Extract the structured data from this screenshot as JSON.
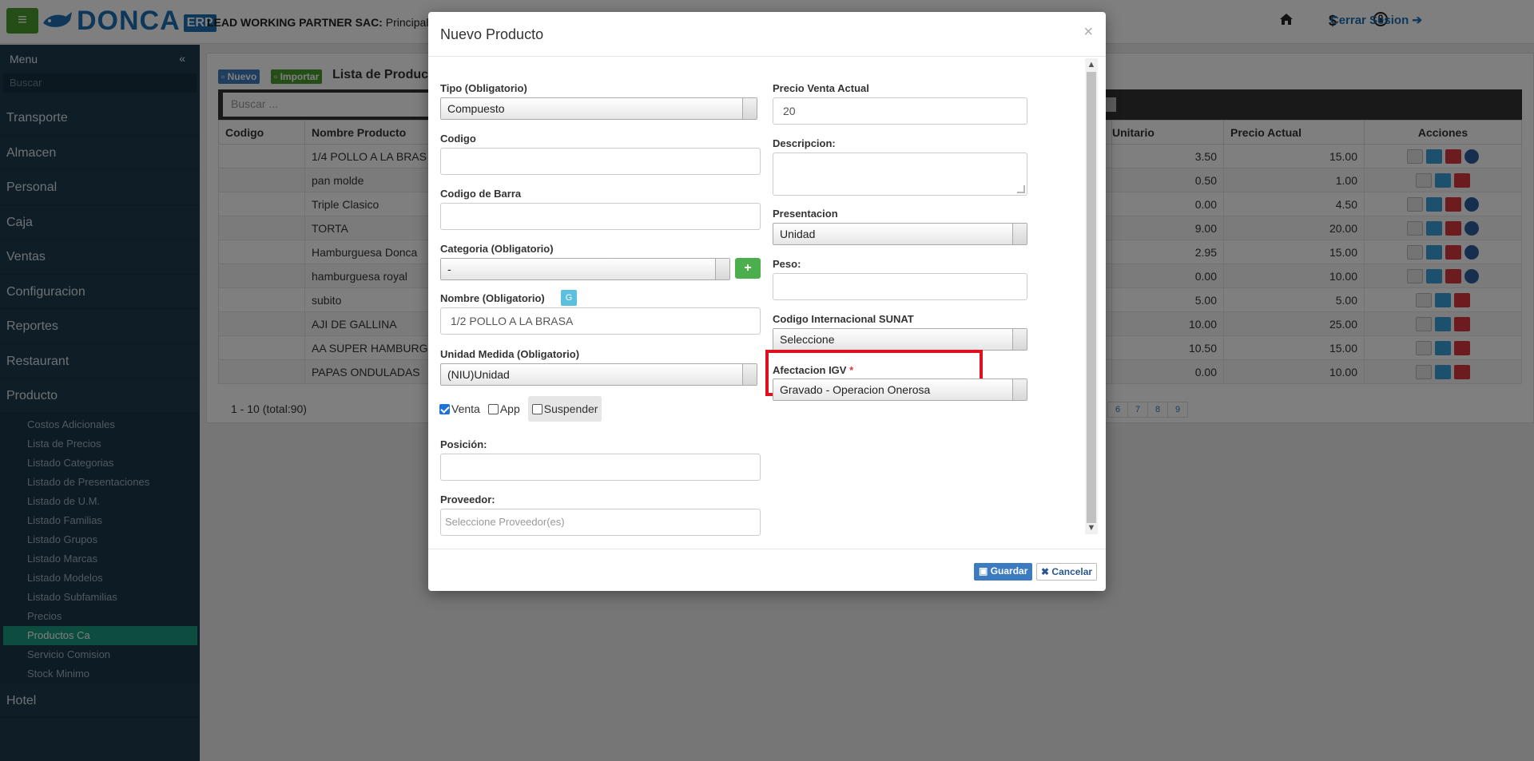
{
  "header": {
    "brand": "DONCA",
    "brand_suffix": "ERP",
    "company_name": "LEAD WORKING PARTNER SAC:",
    "company_branch": "Principal",
    "logout_label": "Cerrar Sesion"
  },
  "sidebar": {
    "title": "Menu",
    "search_placeholder": "Buscar",
    "items": [
      "Transporte",
      "Almacen",
      "Personal",
      "Caja",
      "Ventas",
      "Configuracion",
      "Reportes",
      "Restaurant",
      "Producto"
    ],
    "subitems": [
      "Costos Adicionales",
      "Lista de Precios",
      "Listado Categorias",
      "Listado de Presentaciones",
      "Listado de U.M.",
      "Listado Familias",
      "Listado Grupos",
      "Listado Marcas",
      "Listado Modelos",
      "Listado Subfamilias",
      "Precios",
      "Productos Ca",
      "Servicio Comision",
      "Stock Minimo"
    ],
    "last_item": "Hotel"
  },
  "list": {
    "new_label": "Nuevo",
    "import_label": "Importar",
    "title": "Lista de Produc",
    "search_placeholder": "Buscar ...",
    "columns": [
      "Codigo",
      "Nombre Producto",
      "Unitario",
      "Precio Actual",
      "Acciones"
    ],
    "rows": [
      {
        "name": "1/4 POLLO A LA BRAS",
        "unit": "3.50",
        "price": "15.00"
      },
      {
        "name": "pan molde",
        "unit": "0.50",
        "price": "1.00"
      },
      {
        "name": "Triple Clasico",
        "unit": "0.00",
        "price": "4.50"
      },
      {
        "name": "TORTA",
        "unit": "9.00",
        "price": "20.00"
      },
      {
        "name": "Hamburguesa Donca",
        "unit": "2.95",
        "price": "15.00"
      },
      {
        "name": "hamburguesa royal",
        "unit": "0.00",
        "price": "10.00"
      },
      {
        "name": "subito",
        "unit": "5.00",
        "price": "5.00"
      },
      {
        "name": "AJI DE GALLINA",
        "unit": "10.00",
        "price": "25.00"
      },
      {
        "name": "AA SUPER HAMBURGE",
        "unit": "10.50",
        "price": "15.00"
      },
      {
        "name": "PAPAS ONDULADAS",
        "unit": "0.00",
        "price": "10.00"
      }
    ],
    "pager_info": "1 - 10 (total:90)",
    "pages": [
      "6",
      "7",
      "8",
      "9"
    ]
  },
  "modal": {
    "title": "Nuevo Producto",
    "close": "×",
    "left": {
      "tipo_label": "Tipo (Obligatorio)",
      "tipo_value": "Compuesto",
      "codigo_label": "Codigo",
      "codigo_value": "",
      "barra_label": "Codigo de Barra",
      "barra_value": "",
      "categoria_label": "Categoria (Obligatorio)",
      "categoria_value": "-",
      "nombre_label": "Nombre (Obligatorio)",
      "nombre_badge": "G",
      "nombre_value": "1/2 POLLO A LA BRASA",
      "um_label": "Unidad Medida (Obligatorio)",
      "um_value": "(NIU)Unidad",
      "chk_venta": "Venta",
      "chk_app": "App",
      "chk_suspender": "Suspender",
      "posicion_label": "Posición:",
      "posicion_value": "",
      "proveedor_label": "Proveedor:",
      "proveedor_placeholder": "Seleccione Proveedor(es)"
    },
    "right": {
      "precio_label": "Precio Venta Actual",
      "precio_value": "20",
      "descripcion_label": "Descripcion:",
      "presentacion_label": "Presentacion",
      "presentacion_value": "Unidad",
      "peso_label": "Peso:",
      "peso_value": "",
      "sunat_label": "Codigo Internacional SUNAT",
      "sunat_value": "Seleccione",
      "igv_label": "Afectacion IGV",
      "igv_required": "*",
      "igv_value": "Gravado - Operacion Onerosa"
    },
    "guardar_label": "Guardar",
    "cancelar_label": "Cancelar"
  }
}
